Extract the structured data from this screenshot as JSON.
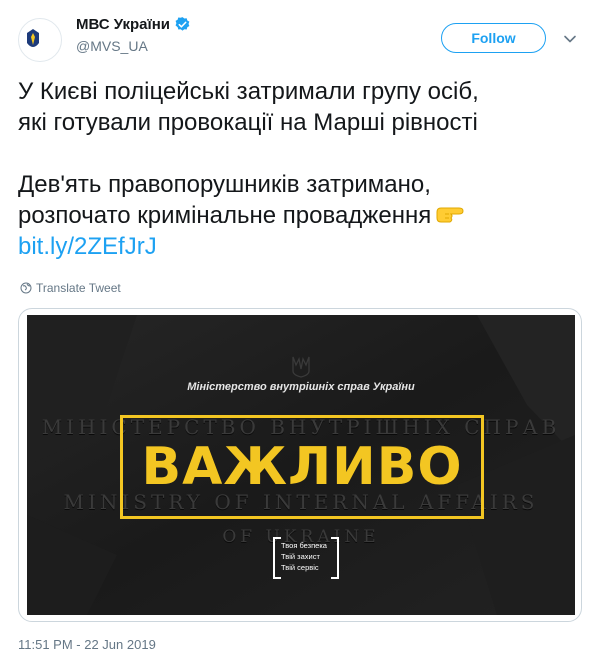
{
  "account": {
    "display_name": "МВС України",
    "handle": "@MVS_UA",
    "avatar_caption": "МІНІСТЕРСТВО ВНУТРІШНІХ СПРАВ УКРАЇНИ"
  },
  "actions": {
    "follow_label": "Follow"
  },
  "tweet": {
    "line1": "У Києві поліцейські затримали групу осіб,",
    "line2": "які готували провокації на Марші рівності",
    "line3": "Дев'ять правопорушників затримано,",
    "line4": "розпочато кримінальне провадження",
    "emoji": "pointing-right-hand",
    "link": "bit.ly/2ZEfJrJ"
  },
  "translate_label": "Translate Tweet",
  "media": {
    "ministry_caption": "Міністерство внутрішніх справ України",
    "headline": "ВАЖЛИВО",
    "engraved_line1": "МІНІСТЕРСТВО ВНУТРІШНІХ СПРАВ",
    "engraved_line2": "MINISTRY OF INTERNAL AFFAIRS",
    "engraved_line3": "OF UKRAINE",
    "slogan": [
      "Твоя безпека",
      "Твій захист",
      "Твій сервіс"
    ],
    "accent_color": "#f3c622"
  },
  "timestamp": "11:51 PM - 22 Jun 2019",
  "colors": {
    "link": "#1da1f2",
    "secondary_text": "#657786"
  }
}
